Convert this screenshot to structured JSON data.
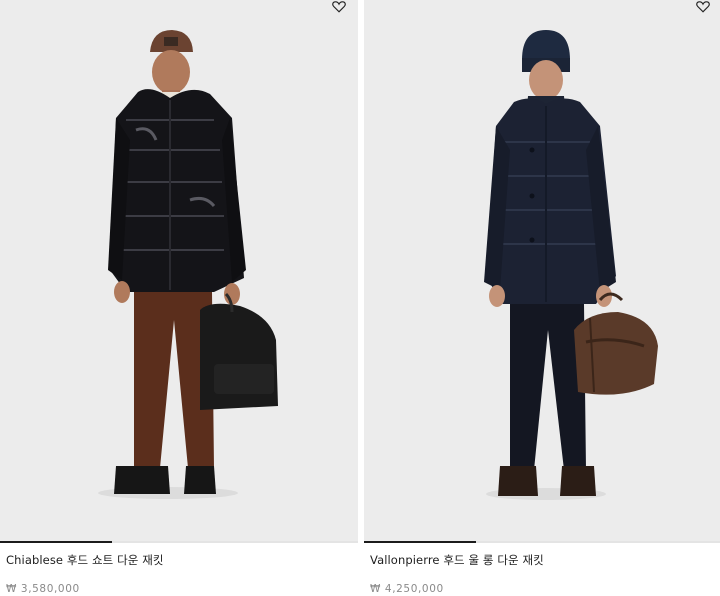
{
  "products": [
    {
      "name": "Chiablese 후드 쇼트 다운 재킷",
      "price": "₩ 3,580,000",
      "wishlist_icon": "heart-outline-icon"
    },
    {
      "name": "Vallonpierre 후드 울 롱 다운 재킷",
      "price": "₩ 4,250,000",
      "wishlist_icon": "heart-outline-icon"
    }
  ]
}
